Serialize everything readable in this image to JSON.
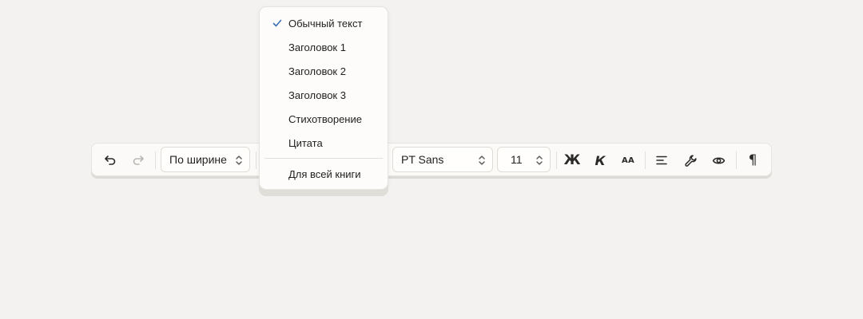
{
  "toolbar": {
    "undo_icon": "undo-icon",
    "redo_icon": "redo-icon",
    "align_select": {
      "value": "По ширине"
    },
    "font_select": {
      "value": "PT Sans"
    },
    "size_select": {
      "value": "11"
    },
    "bold_label": "Ж",
    "italic_label": "К",
    "case_label": "AA",
    "align_icon": "align-left-icon",
    "tools_icon": "wrench-icon",
    "preview_icon": "eye-icon",
    "paragraph_label": "¶"
  },
  "dropdown": {
    "items": [
      {
        "label": "Обычный текст",
        "selected": true
      },
      {
        "label": "Заголовок 1",
        "selected": false
      },
      {
        "label": "Заголовок 2",
        "selected": false
      },
      {
        "label": "Заголовок 3",
        "selected": false
      },
      {
        "label": "Стихотворение",
        "selected": false
      },
      {
        "label": "Цитата",
        "selected": false
      }
    ],
    "footer_item": {
      "label": "Для всей книги"
    }
  },
  "colors": {
    "background": "#f3f2f0",
    "toolbar_bg": "#fbfaf8",
    "check_accent": "#3b6fb6",
    "disabled_icon": "#b9b7b3"
  }
}
